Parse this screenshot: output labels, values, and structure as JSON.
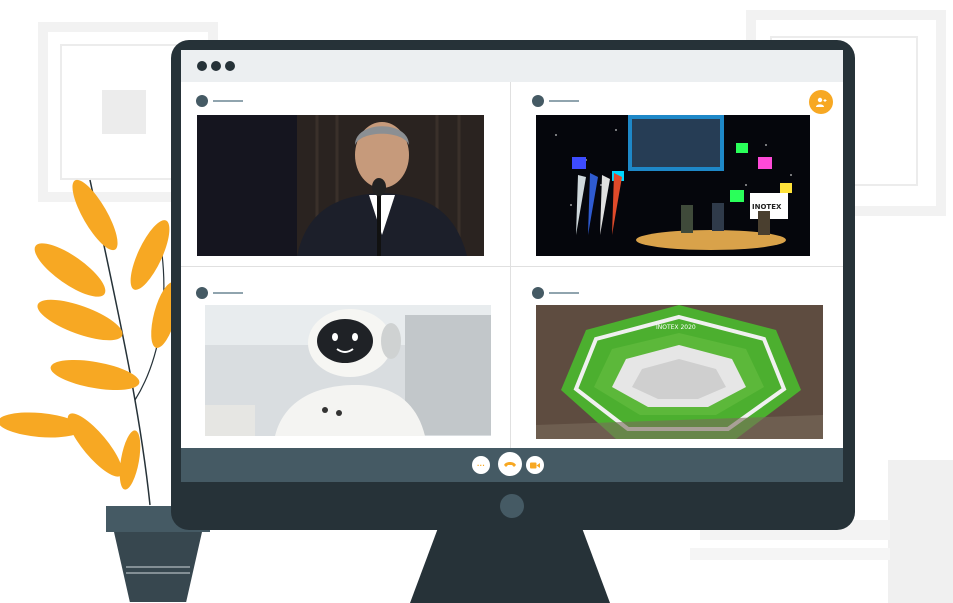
{
  "window": {
    "controls": [
      "dot",
      "dot",
      "dot"
    ]
  },
  "tiles": [
    {
      "id": "participant-1",
      "image": "man-at-podium-photo"
    },
    {
      "id": "participant-2",
      "image": "inotex-panel-stage-photo"
    },
    {
      "id": "participant-3",
      "image": "humanoid-robot-photo"
    },
    {
      "id": "participant-4",
      "image": "inotex-2020-model-photo"
    }
  ],
  "screen_texts": {
    "stage_banner": "INOTEX",
    "model_label": "INOTEX 2020"
  },
  "toolbar": {
    "add_participant_icon": "add-user-icon",
    "more_icon": "more-dots-icon",
    "end_call_icon": "phone-end-icon",
    "video_icon": "video-camera-icon",
    "more_glyph": "···"
  },
  "colors": {
    "accent": "#f7a823",
    "frame": "#263238",
    "bar": "#455a64",
    "leaf": "#f7a823"
  }
}
